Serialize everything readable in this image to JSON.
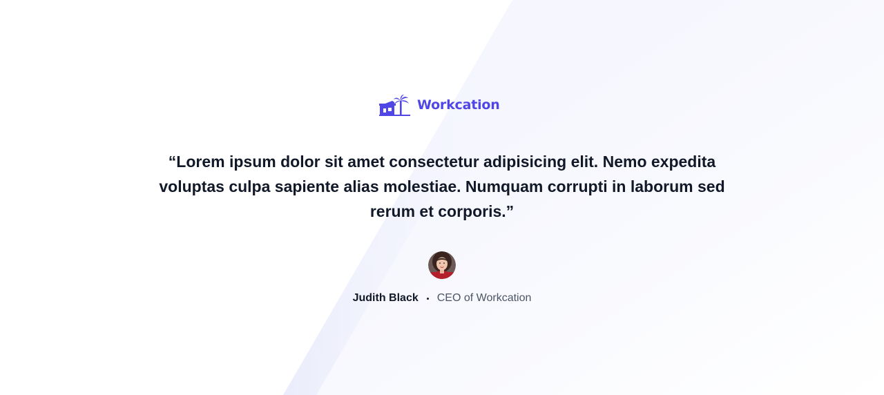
{
  "brand": {
    "name": "Workcation",
    "logo_icon": "house-palm-icon",
    "color": "#4f46e5"
  },
  "testimonial": {
    "quote": "“Lorem ipsum dolor sit amet consectetur adipisicing elit. Nemo expedita voluptas culpa sapiente alias molestiae. Numquam corrupti in laborum sed rerum et corporis.”",
    "author": {
      "name": "Judith Black",
      "role": "CEO of Workcation",
      "avatar_icon": "avatar-photo"
    }
  },
  "colors": {
    "text": "#111827",
    "muted": "#4b5563",
    "background_tint": "#f5f6fd"
  }
}
